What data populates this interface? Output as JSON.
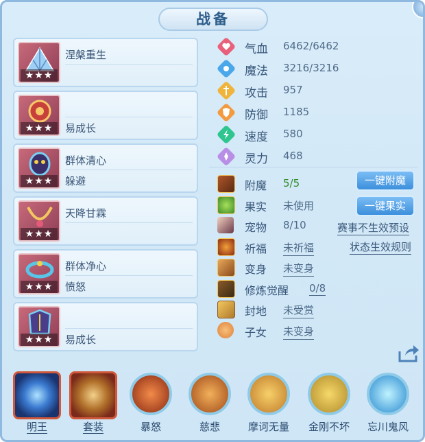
{
  "title": "战备",
  "equipment": [
    {
      "skill1": "涅槃重生",
      "skill2": "",
      "stars": "★★★",
      "icon": "fan-icon"
    },
    {
      "skill1": "",
      "skill2": "易成长",
      "stars": "★★★",
      "icon": "claw-icon"
    },
    {
      "skill1": "群体清心",
      "skill2": "躲避",
      "stars": "★★★",
      "icon": "mask-icon"
    },
    {
      "skill1": "天降甘霖",
      "skill2": "",
      "stars": "★★★",
      "icon": "necklace-icon"
    },
    {
      "skill1": "群体净心",
      "skill2": "愤怒",
      "stars": "★★★",
      "icon": "bracelet-icon"
    },
    {
      "skill1": "",
      "skill2": "易成长",
      "stars": "★★★",
      "icon": "armor-icon"
    }
  ],
  "stats": [
    {
      "label": "气血",
      "value": "6462/6462",
      "icon": "heart-icon",
      "color": "#e8607a"
    },
    {
      "label": "魔法",
      "value": "3216/3216",
      "icon": "mana-icon",
      "color": "#4aa7ea"
    },
    {
      "label": "攻击",
      "value": "957",
      "icon": "sword-icon",
      "color": "#f0b43c"
    },
    {
      "label": "防御",
      "value": "1185",
      "icon": "shield-icon",
      "color": "#f39a3e"
    },
    {
      "label": "速度",
      "value": "580",
      "icon": "speed-icon",
      "color": "#2ec58f"
    },
    {
      "label": "灵力",
      "value": "468",
      "icon": "spirit-icon",
      "color": "#b98ee6"
    }
  ],
  "attributes": [
    {
      "label": "附魔",
      "value": "5/5",
      "icon": "enchant-icon"
    },
    {
      "label": "果实",
      "value": "未使用",
      "icon": "fruit-icon"
    },
    {
      "label": "宠物",
      "value": "8/10",
      "icon": "pet-icon"
    },
    {
      "label": "祈福",
      "value": "未祈福",
      "icon": "pray-icon"
    },
    {
      "label": "变身",
      "value": "未变身",
      "icon": "transform-icon"
    },
    {
      "label": "修炼觉醒",
      "value": "0/8",
      "icon": "cultivate-icon"
    },
    {
      "label": "封地",
      "value": "未受赏",
      "icon": "fief-icon"
    },
    {
      "label": "子女",
      "value": "未变身",
      "icon": "child-icon"
    }
  ],
  "buttons": {
    "enchant_all": "一键附魔",
    "fruit_all": "一键果实"
  },
  "links": {
    "event_preset": "赛事不生效预设",
    "status_rules": "状态生效规则"
  },
  "bottom_slots": [
    {
      "label": "明王",
      "icon": "mingwang-icon"
    },
    {
      "label": "套装",
      "icon": "set-icon"
    },
    {
      "label": "暴怒",
      "icon": "rage-icon"
    },
    {
      "label": "慈悲",
      "icon": "mercy-icon"
    },
    {
      "label": "摩诃无量",
      "icon": "mohe-icon"
    },
    {
      "label": "金刚不坏",
      "icon": "vajra-icon"
    },
    {
      "label": "忘川鬼风",
      "icon": "ghostwind-icon"
    }
  ]
}
